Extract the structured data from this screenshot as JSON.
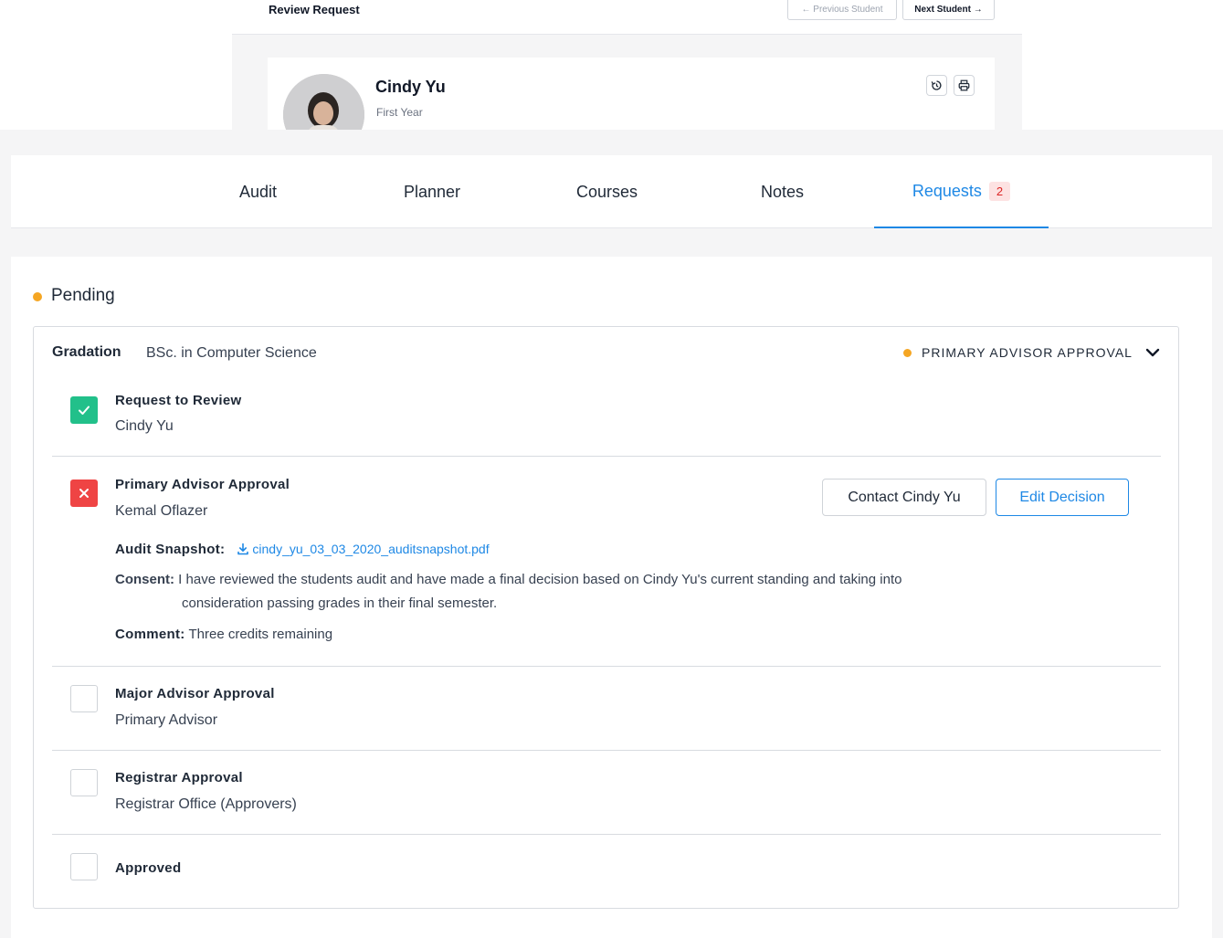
{
  "header": {
    "title": "Review Request",
    "prev_label": "← Previous Student",
    "next_label": "Next Student →"
  },
  "student": {
    "name": "Cindy Yu",
    "year": "First Year"
  },
  "tabs": [
    {
      "label": "Audit"
    },
    {
      "label": "Planner"
    },
    {
      "label": "Courses"
    },
    {
      "label": "Notes"
    },
    {
      "label": "Requests",
      "badge": "2"
    }
  ],
  "section": {
    "title": "Pending"
  },
  "request": {
    "label": "Gradation",
    "program": "BSc. in Computer Science",
    "status": "PRIMARY ADVISOR APPROVAL",
    "steps": [
      {
        "title": "Request to Review",
        "subtitle": "Cindy Yu",
        "state": "approved"
      },
      {
        "title": "Primary Advisor Approval",
        "subtitle": "Kemal Oflazer",
        "state": "rejected"
      },
      {
        "title": "Major Advisor Approval",
        "subtitle": "Primary Advisor",
        "state": "pending"
      },
      {
        "title": "Registrar Approval",
        "subtitle": "Registrar Office (Approvers)",
        "state": "pending"
      },
      {
        "title": "Approved",
        "subtitle": "",
        "state": "pending"
      }
    ],
    "actions": {
      "contact_label": "Contact Cindy Yu",
      "edit_label": "Edit Decision"
    },
    "details": {
      "snapshot_label": "Audit Snapshot:",
      "snapshot_file": "cindy_yu_03_03_2020_auditsnapshot.pdf",
      "consent_label": "Consent:",
      "consent_line1": "I have reviewed the students audit and have made a final decision based on Cindy Yu's current standing and taking into",
      "consent_line2": "consideration passing grades in their final semester.",
      "comment_label": "Comment:",
      "comment_text": "Three credits remaining"
    }
  },
  "colors": {
    "accent": "#1e88e5",
    "pending": "#f5a623",
    "success": "#22c08a",
    "danger": "#ef4444"
  },
  "icons": [
    "history-icon",
    "print-icon",
    "chevron-down-icon",
    "check-icon",
    "close-icon",
    "download-icon"
  ]
}
